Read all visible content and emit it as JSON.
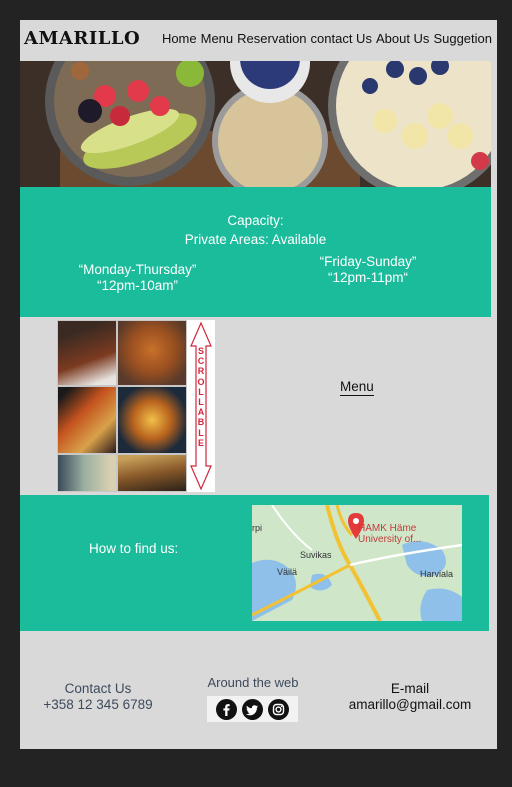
{
  "header": {
    "logo": "AMARILLO",
    "nav": [
      "Home",
      "Menu",
      "Reservation",
      "contact Us",
      "About Us",
      "Suggetion"
    ]
  },
  "capacity": {
    "title": "Capacity:",
    "private_areas": "Private Areas: Available",
    "weekday_days": "“Monday-Thursday”",
    "weekday_hours": "“12pm-10am”",
    "weekend_days": "“Friday-Sunday”",
    "weekend_hours": "“12pm-11pm“"
  },
  "menu_section": {
    "scroll_label": "SCROLLABLE",
    "menu_link": "Menu"
  },
  "find_us": {
    "label": "How to find us:",
    "map": {
      "place_name": "HAMK Häme",
      "place_sub": "University of...",
      "labels": [
        "Suvikas",
        "Väilä",
        "Harviala",
        "rpi"
      ]
    }
  },
  "footer": {
    "contact_title": "Contact Us",
    "contact_phone": "+358 12 345 6789",
    "web_title": "Around the web",
    "social": [
      "facebook-icon",
      "twitter-icon",
      "instagram-icon"
    ],
    "email_title": "E-mail",
    "email_address": "amarillo@gmail.com"
  },
  "colors": {
    "accent": "#1bbc9b",
    "page_bg": "#d9d9d9",
    "frame_bg": "#232323"
  }
}
